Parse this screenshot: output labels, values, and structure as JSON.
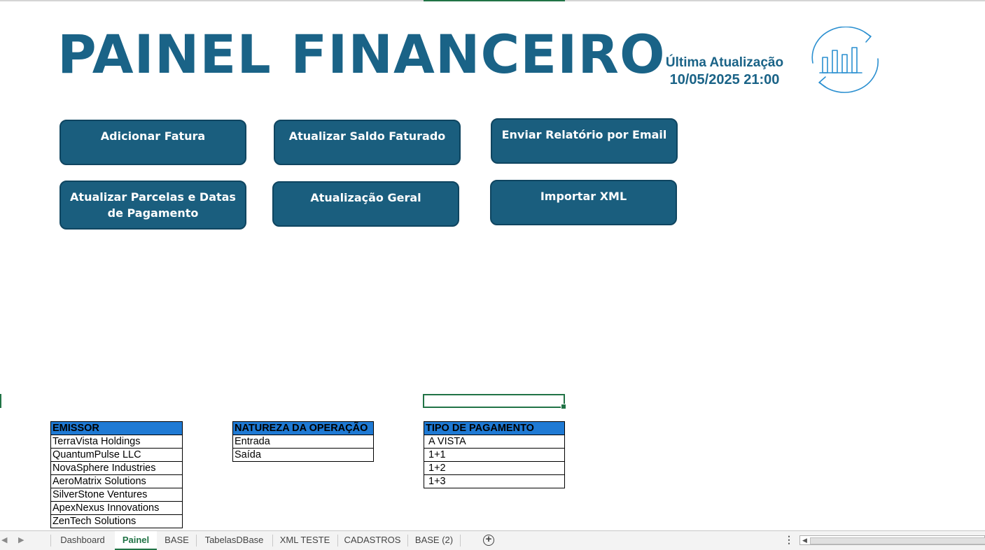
{
  "title": "PAINEL FINANCEIRO",
  "update": {
    "label": "Última Atualização",
    "value": "10/05/2025 21:00"
  },
  "buttons": {
    "add_invoice": "Adicionar Fatura",
    "update_balance": "Atualizar Saldo Faturado",
    "send_report": "Enviar Relatório por Email",
    "update_installments": "Atualizar Parcelas e Datas de Pagamento",
    "general_update": "Atualização Geral",
    "import_xml": "Importar XML"
  },
  "tables": {
    "emissor": {
      "header": "EMISSOR",
      "rows": [
        "TerraVista Holdings",
        "QuantumPulse LLC",
        "NovaSphere Industries",
        "AeroMatrix Solutions",
        "SilverStone Ventures",
        "ApexNexus Innovations",
        "ZenTech Solutions"
      ]
    },
    "natureza": {
      "header": "NATUREZA DA OPERAÇÃO",
      "rows": [
        "Entrada",
        "Saída"
      ]
    },
    "tipo_pagamento": {
      "header": "TIPO DE PAGAMENTO",
      "rows": [
        "A VISTA",
        "1+1",
        "1+2",
        "1+3"
      ]
    }
  },
  "sheet_tabs": [
    "Dashboard",
    "Painel",
    "BASE",
    "TabelasDBase",
    "XML TESTE",
    "CADASTROS",
    "BASE (2)"
  ],
  "active_tab": "Painel",
  "colors": {
    "primary": "#1a5e7e",
    "title": "#1a6387",
    "header_fill": "#1f7ad4",
    "excel_green": "#217346",
    "logo_stroke": "#2a8fd0"
  },
  "icons": {
    "logo": "chart-refresh-icon",
    "add_sheet": "plus-circle-icon"
  }
}
